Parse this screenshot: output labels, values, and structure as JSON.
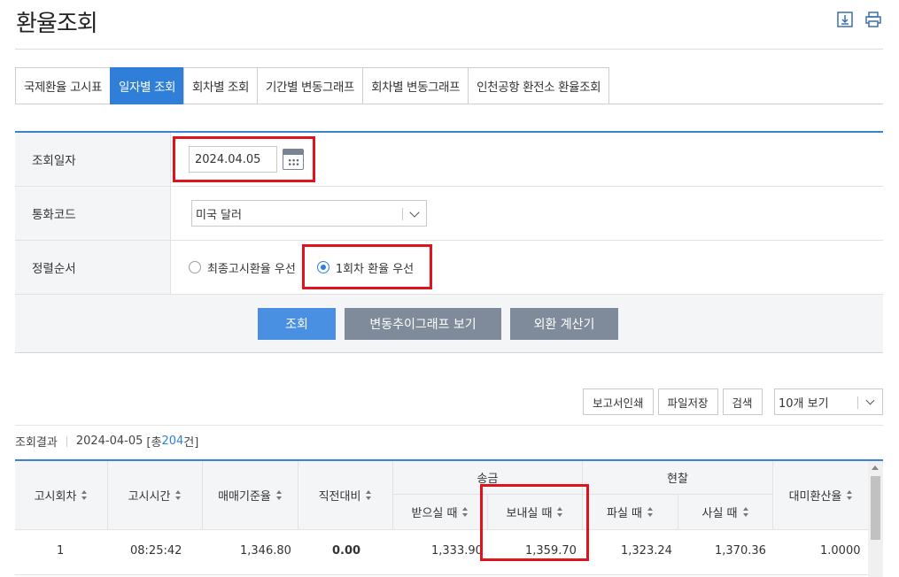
{
  "page": {
    "title": "환율조회"
  },
  "header_icons": {
    "download": "download-icon",
    "print": "print-icon"
  },
  "tabs": [
    {
      "label": "국제환율 고시표",
      "active": false
    },
    {
      "label": "일자별 조회",
      "active": true
    },
    {
      "label": "회차별 조회",
      "active": false
    },
    {
      "label": "기간별 변동그래프",
      "active": false
    },
    {
      "label": "회차별 변동그래프",
      "active": false
    },
    {
      "label": "인천공항 환전소 환율조회",
      "active": false
    }
  ],
  "form": {
    "date_label": "조회일자",
    "date_value": "2024.04.05",
    "currency_label": "통화코드",
    "currency_value": "미국 달러",
    "sort_label": "정렬순서",
    "sort_options": [
      "최종고시환율 우선",
      "1회차 환율 우선"
    ],
    "sort_selected": "1회차 환율 우선"
  },
  "buttons": {
    "search": "조회",
    "trend_graph": "변동추이그래프 보기",
    "calculator": "외환 계산기"
  },
  "tools": {
    "print_report": "보고서인쇄",
    "save_file": "파일저장",
    "search": "검색",
    "page_size": "10개 보기"
  },
  "summary": {
    "label": "조회결과",
    "date": "2024-04-05",
    "total_prefix": "[총 ",
    "total_count": "204",
    "total_suffix": "건]"
  },
  "table": {
    "headers": {
      "round": "고시회차",
      "time": "고시시간",
      "base_rate": "매매기준율",
      "change": "직전대비",
      "remit_group": "송금",
      "remit_receive": "받으실 때",
      "remit_send": "보내실 때",
      "cash_group": "현찰",
      "cash_sell": "파실 때",
      "cash_buy": "사실 때",
      "usd_rate": "대미환산율"
    },
    "rows": [
      {
        "round": "1",
        "time": "08:25:42",
        "base_rate": "1,346.80",
        "change": "0.00",
        "remit_receive": "1,333.90",
        "remit_send": "1,359.70",
        "cash_sell": "1,323.24",
        "cash_buy": "1,370.36",
        "usd_rate": "1.0000"
      }
    ]
  },
  "colors": {
    "accent": "#2f7fd8",
    "highlight": "#e0121b",
    "gray_button": "#7f8b9a"
  }
}
